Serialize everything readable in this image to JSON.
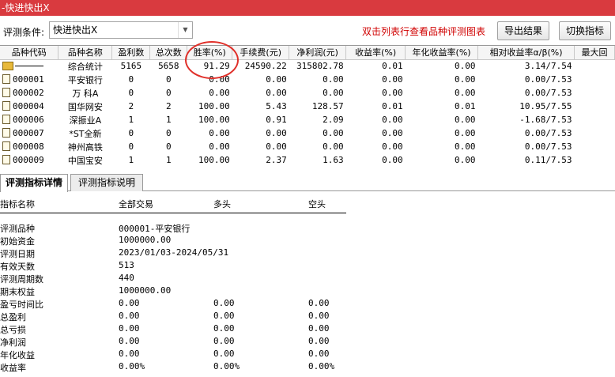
{
  "window": {
    "title": "-快进快出X"
  },
  "condition": {
    "label": "评测条件:",
    "value": "快进快出X",
    "hint": "双击列表行查看品种评测图表",
    "export_label": "导出结果",
    "switch_label": "切换指标"
  },
  "table": {
    "columns": [
      "品种代码",
      "品种名称",
      "盈利数",
      "总次数",
      "胜率(%)",
      "手续费(元)",
      "净利润(元)",
      "收益率(%)",
      "年化收益率(%)",
      "相对收益率α/β(%)",
      "最大回"
    ],
    "rows": [
      {
        "code": "",
        "name": "综合统计",
        "wins": "5165",
        "total": "5658",
        "winrate": "91.29",
        "fee": "24590.22",
        "profit": "315802.78",
        "ret": "0.01",
        "annual": "0.00",
        "relative": "3.14/7.54"
      },
      {
        "code": "000001",
        "name": "平安银行",
        "wins": "0",
        "total": "0",
        "winrate": "0.00",
        "fee": "0.00",
        "profit": "0.00",
        "ret": "0.00",
        "annual": "0.00",
        "relative": "0.00/7.53"
      },
      {
        "code": "000002",
        "name": "万 科A",
        "wins": "0",
        "total": "0",
        "winrate": "0.00",
        "fee": "0.00",
        "profit": "0.00",
        "ret": "0.00",
        "annual": "0.00",
        "relative": "0.00/7.53"
      },
      {
        "code": "000004",
        "name": "国华网安",
        "wins": "2",
        "total": "2",
        "winrate": "100.00",
        "fee": "5.43",
        "profit": "128.57",
        "ret": "0.01",
        "annual": "0.01",
        "relative": "10.95/7.55"
      },
      {
        "code": "000006",
        "name": "深振业A",
        "wins": "1",
        "total": "1",
        "winrate": "100.00",
        "fee": "0.91",
        "profit": "2.09",
        "ret": "0.00",
        "annual": "0.00",
        "relative": "-1.68/7.53"
      },
      {
        "code": "000007",
        "name": "*ST全新",
        "wins": "0",
        "total": "0",
        "winrate": "0.00",
        "fee": "0.00",
        "profit": "0.00",
        "ret": "0.00",
        "annual": "0.00",
        "relative": "0.00/7.53"
      },
      {
        "code": "000008",
        "name": "神州高铁",
        "wins": "0",
        "total": "0",
        "winrate": "0.00",
        "fee": "0.00",
        "profit": "0.00",
        "ret": "0.00",
        "annual": "0.00",
        "relative": "0.00/7.53"
      },
      {
        "code": "000009",
        "name": "中国宝安",
        "wins": "1",
        "total": "1",
        "winrate": "100.00",
        "fee": "2.37",
        "profit": "1.63",
        "ret": "0.00",
        "annual": "0.00",
        "relative": "0.11/7.53"
      }
    ]
  },
  "tabs": [
    "评测指标详情",
    "评测指标说明"
  ],
  "detail": {
    "headers": [
      "指标名称",
      "全部交易",
      "多头",
      "空头"
    ],
    "rows": [
      {
        "name": "评测品种",
        "all": "000001-平安银行",
        "long": "",
        "short": ""
      },
      {
        "name": "初始资金",
        "all": "1000000.00",
        "long": "",
        "short": ""
      },
      {
        "name": "评测日期",
        "all": "2023/01/03-2024/05/31",
        "long": "",
        "short": ""
      },
      {
        "name": "有效天数",
        "all": "513",
        "long": "",
        "short": ""
      },
      {
        "name": "评测周期数",
        "all": "440",
        "long": "",
        "short": ""
      },
      {
        "name": "期末权益",
        "all": "1000000.00",
        "long": "",
        "short": ""
      },
      {
        "name": "盈亏时间比",
        "all": "0.00",
        "long": "0.00",
        "short": "0.00"
      },
      {
        "name": "总盈利",
        "all": "0.00",
        "long": "0.00",
        "short": "0.00"
      },
      {
        "name": "总亏损",
        "all": "0.00",
        "long": "0.00",
        "short": "0.00"
      },
      {
        "name": "净利润",
        "all": "0.00",
        "long": "0.00",
        "short": "0.00"
      },
      {
        "name": "年化收益",
        "all": "0.00",
        "long": "0.00",
        "short": "0.00"
      },
      {
        "name": "收益率",
        "all": "0.00%",
        "long": "0.00%",
        "short": "0.00%"
      }
    ]
  },
  "colors": {
    "titlebar": "#d93a3f",
    "hint": "#d00000",
    "highlight_circle": "#e0302a"
  }
}
